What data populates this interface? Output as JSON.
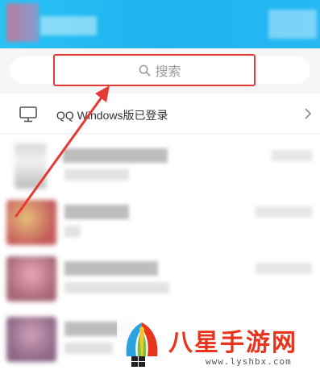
{
  "search": {
    "placeholder": "搜索"
  },
  "windows_login": {
    "label": "QQ Windows版已登录"
  },
  "watermark": {
    "title": "八星手游网",
    "url": "www.lyshbx.com"
  },
  "icons": {
    "search": "search-icon",
    "monitor": "monitor-icon",
    "chevron": "chevron-right-icon"
  },
  "colors": {
    "header": "#1fb3f0",
    "highlight": "#e53935",
    "watermark": "#e8341c"
  }
}
